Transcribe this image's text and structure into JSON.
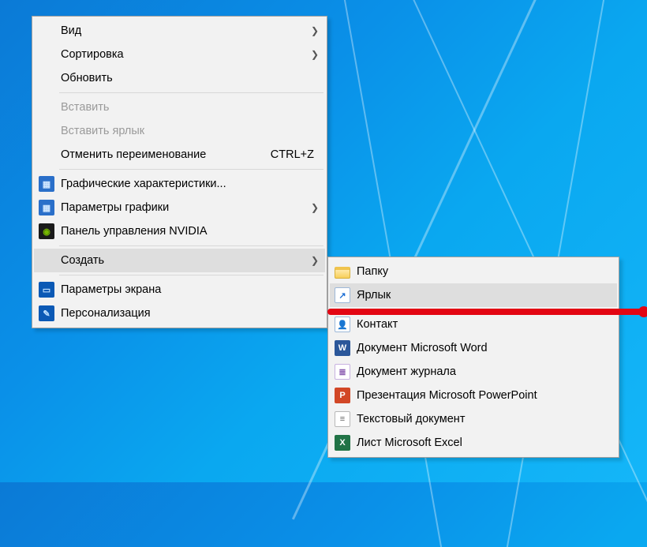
{
  "main_menu": {
    "items": [
      {
        "label": "Вид",
        "has_submenu": true
      },
      {
        "label": "Сортировка",
        "has_submenu": true
      },
      {
        "label": "Обновить"
      },
      "sep",
      {
        "label": "Вставить",
        "disabled": true
      },
      {
        "label": "Вставить ярлык",
        "disabled": true
      },
      {
        "label": "Отменить переименование",
        "shortcut": "CTRL+Z"
      },
      "sep",
      {
        "label": "Графические характеристики...",
        "icon": "intel-icon"
      },
      {
        "label": "Параметры графики",
        "icon": "intel-icon",
        "has_submenu": true
      },
      {
        "label": "Панель управления NVIDIA",
        "icon": "nvidia-icon"
      },
      "sep",
      {
        "label": "Создать",
        "has_submenu": true,
        "highlighted": true
      },
      "sep",
      {
        "label": "Параметры экрана",
        "icon": "display-icon"
      },
      {
        "label": "Персонализация",
        "icon": "personalize-icon"
      }
    ]
  },
  "submenu_new": {
    "items": [
      {
        "label": "Папку",
        "icon": "folder-icon"
      },
      {
        "label": "Ярлык",
        "icon": "shortcut-icon",
        "highlighted": true
      },
      "sep",
      {
        "label": "Контакт",
        "icon": "contact-icon"
      },
      {
        "label": "Документ Microsoft Word",
        "icon": "word-icon"
      },
      {
        "label": "Документ журнала",
        "icon": "journal-icon"
      },
      {
        "label": "Презентация Microsoft PowerPoint",
        "icon": "powerpoint-icon"
      },
      {
        "label": "Текстовый документ",
        "icon": "text-icon"
      },
      {
        "label": "Лист Microsoft Excel",
        "icon": "excel-icon"
      }
    ]
  },
  "icons": {
    "intel-icon": {
      "bg": "#2a6fc9",
      "glyph": "▦",
      "fg": "#cfe6ff"
    },
    "nvidia-icon": {
      "bg": "#1a1a1a",
      "glyph": "◉",
      "fg": "#76b900"
    },
    "display-icon": {
      "bg": "#0b59b5",
      "glyph": "▭",
      "fg": "#bfe0ff"
    },
    "personalize-icon": {
      "bg": "#0b59b5",
      "glyph": "✎",
      "fg": "#bfe0ff"
    },
    "folder-icon": {
      "bg": "#ffe9a8",
      "glyph": "",
      "fg": "#d8b13a",
      "folder": true
    },
    "shortcut-icon": {
      "bg": "#ffffff",
      "glyph": "↗",
      "fg": "#1d6fd4",
      "border": "#9db8d8"
    },
    "contact-icon": {
      "bg": "#ffffff",
      "glyph": "👤",
      "fg": "#555",
      "border": "#9db8d8"
    },
    "word-icon": {
      "bg": "#2b579a",
      "glyph": "W",
      "fg": "#fff"
    },
    "journal-icon": {
      "bg": "#ffffff",
      "glyph": "≣",
      "fg": "#8a5bb0",
      "border": "#c8b2e0"
    },
    "powerpoint-icon": {
      "bg": "#d24726",
      "glyph": "P",
      "fg": "#fff"
    },
    "text-icon": {
      "bg": "#ffffff",
      "glyph": "≡",
      "fg": "#666",
      "border": "#b8b8b8"
    },
    "excel-icon": {
      "bg": "#217346",
      "glyph": "X",
      "fg": "#fff"
    }
  }
}
